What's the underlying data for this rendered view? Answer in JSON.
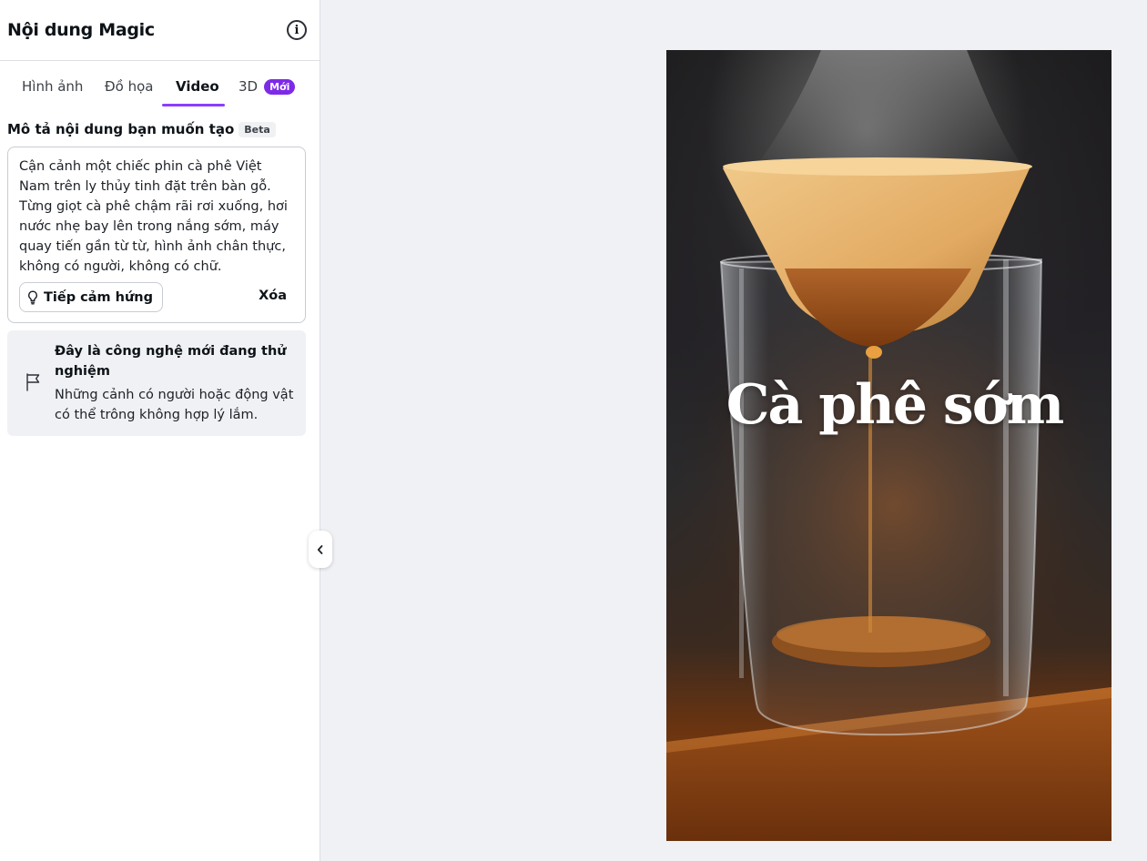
{
  "panel": {
    "title": "Nội dung Magic",
    "tabs": [
      {
        "label": "Hình ảnh"
      },
      {
        "label": "Đồ họa"
      },
      {
        "label": "Video",
        "active": true
      },
      {
        "label": "3D",
        "badge": "Mới"
      }
    ],
    "prompt_label": "Mô tả nội dung bạn muốn tạo",
    "prompt_badge": "Beta",
    "prompt_value": "Cận cảnh một chiếc phin cà phê Việt Nam trên ly thủy tinh đặt trên bàn gỗ. Từng giọt cà phê chậm rãi rơi xuống, hơi nước nhẹ bay lên trong nắng sớm, máy quay tiến gần từ từ, hình ảnh chân thực, không có người, không có chữ.",
    "inspire_label": "Tiếp cảm hứng",
    "clear_label": "Xóa",
    "notice_title": "Đây là công nghệ mới đang thử nghiệm",
    "notice_body": "Những cảnh có người hoặc động vật có thể trông không hợp lý lắm."
  },
  "preview": {
    "overlay_text": "Cà phê sớm"
  },
  "colors": {
    "accent": "#8b3dff",
    "badge": "#7d2ae8"
  },
  "icons": [
    "info-icon",
    "lightbulb-icon",
    "flag-icon",
    "chevron-left-icon"
  ]
}
